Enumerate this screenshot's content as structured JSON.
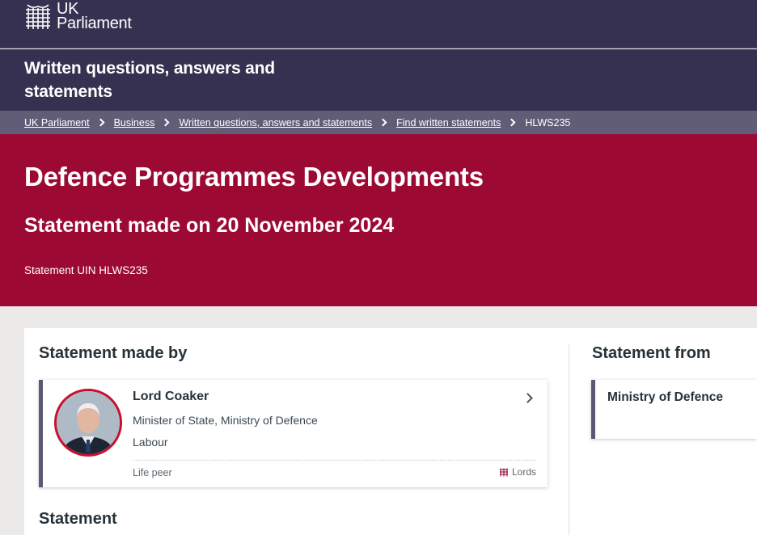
{
  "header": {
    "logo_line1": "UK",
    "logo_line2": "Parliament",
    "logo_icon": "portcullis-icon",
    "section_title": "Written questions, answers and statements"
  },
  "breadcrumb": {
    "items": [
      "UK Parliament",
      "Business",
      "Written questions, answers and statements",
      "Find written statements"
    ],
    "current": "HLWS235"
  },
  "hero": {
    "title": "Defence Programmes Developments",
    "subtitle": "Statement made on 20 November 2024",
    "uin": "Statement UIN HLWS235"
  },
  "made_by": {
    "heading": "Statement made by",
    "member": {
      "name": "Lord Coaker",
      "role": "Minister of State, Ministry of Defence",
      "party": "Labour",
      "membership": "Life peer",
      "house": "Lords",
      "house_icon": "portcullis-icon",
      "party_color": "#c8102e"
    }
  },
  "statement_from": {
    "heading": "Statement from",
    "department": "Ministry of Defence"
  },
  "statement": {
    "heading": "Statement"
  },
  "colors": {
    "header": "#373151",
    "breadcrumb": "#625d76",
    "hero": "#9c0a34",
    "accent_border": "#5d5876"
  }
}
